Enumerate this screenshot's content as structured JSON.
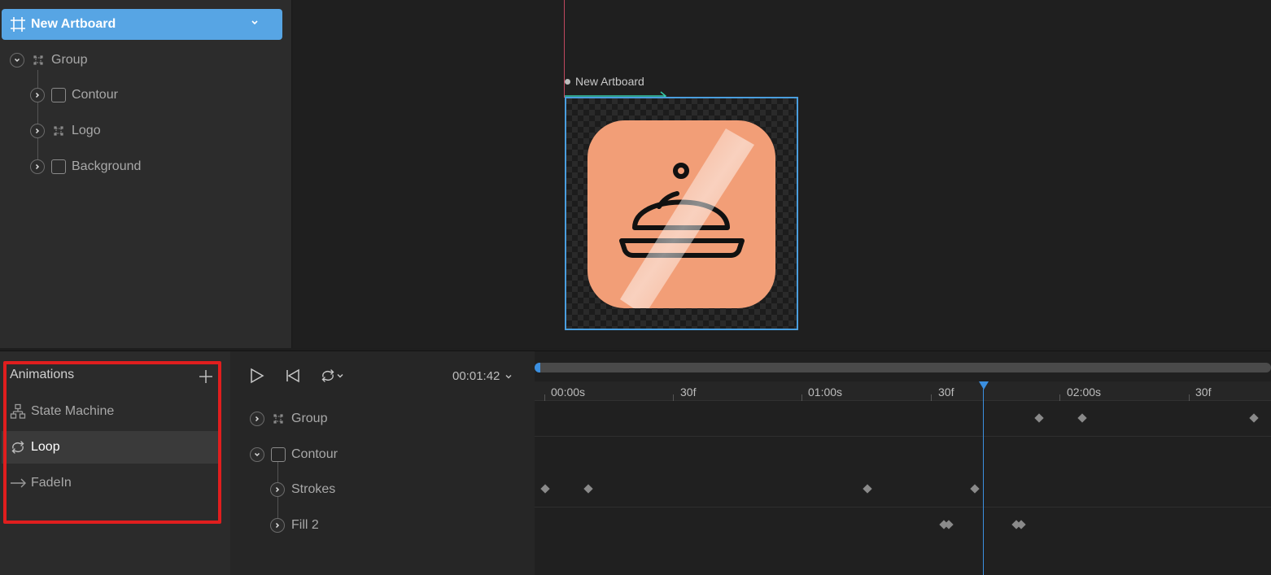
{
  "hierarchy": {
    "artboard_name": "New Artboard",
    "nodes": [
      {
        "label": "Group",
        "icon": "group-icon"
      },
      {
        "label": "Contour",
        "icon": "shape-icon"
      },
      {
        "label": "Logo",
        "icon": "group-icon"
      },
      {
        "label": "Background",
        "icon": "shape-icon"
      }
    ]
  },
  "stage": {
    "artboard_label": "New Artboard",
    "icon_color": "#f29e77",
    "selection_color": "#4a9ede"
  },
  "animations": {
    "header": "Animations",
    "items": [
      {
        "label": "State Machine",
        "icon": "state-machine-icon"
      },
      {
        "label": "Loop",
        "icon": "loop-icon",
        "selected": true
      },
      {
        "label": "FadeIn",
        "icon": "arrow-right-icon"
      }
    ]
  },
  "timeline": {
    "time": "00:01:42",
    "tree": [
      {
        "label": "Group"
      },
      {
        "label": "Contour"
      },
      {
        "label": "Strokes"
      },
      {
        "label": "Fill 2"
      }
    ],
    "ruler": [
      "00:00s",
      "30f",
      "01:00s",
      "30f",
      "02:00s",
      "30f"
    ]
  }
}
